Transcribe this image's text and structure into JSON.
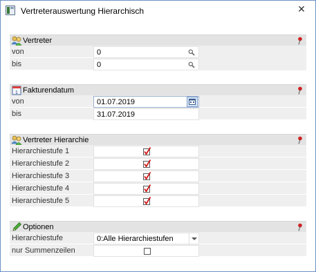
{
  "window": {
    "title": "Vertreterauswertung Hierarchisch",
    "close_glyph": "✕"
  },
  "sections": {
    "vertreter": {
      "title": "Vertreter",
      "icon": "users-icon",
      "rows": [
        {
          "label": "von",
          "value": "0"
        },
        {
          "label": "bis",
          "value": "0"
        }
      ]
    },
    "fakturendatum": {
      "title": "Fakturendatum",
      "icon": "calendar-icon",
      "rows": [
        {
          "label": "von",
          "value": "01.07.2019"
        },
        {
          "label": "bis",
          "value": "31.07.2019"
        }
      ]
    },
    "hierarchie": {
      "title": "Vertreter Hierarchie",
      "icon": "users-icon",
      "rows": [
        {
          "label": "Hierarchiestufe 1",
          "checked": true
        },
        {
          "label": "Hierarchiestufe 2",
          "checked": true
        },
        {
          "label": "Hierarchiestufe 3",
          "checked": true
        },
        {
          "label": "Hierarchiestufe 4",
          "checked": true
        },
        {
          "label": "Hierarchiestufe 5",
          "checked": true
        }
      ]
    },
    "optionen": {
      "title": "Optionen",
      "icon": "pencil-icon",
      "rows": [
        {
          "label": "Hierarchiestufe",
          "value": "0:Alle Hierarchiestufen"
        },
        {
          "label": "nur Summenzeilen",
          "checked": false
        }
      ]
    }
  },
  "colors": {
    "section_header": "#e3e3e3",
    "row_background": "#efefef",
    "check_mark": "#d01818",
    "pin": "#c01818",
    "window_border": "#6b8fc4"
  }
}
